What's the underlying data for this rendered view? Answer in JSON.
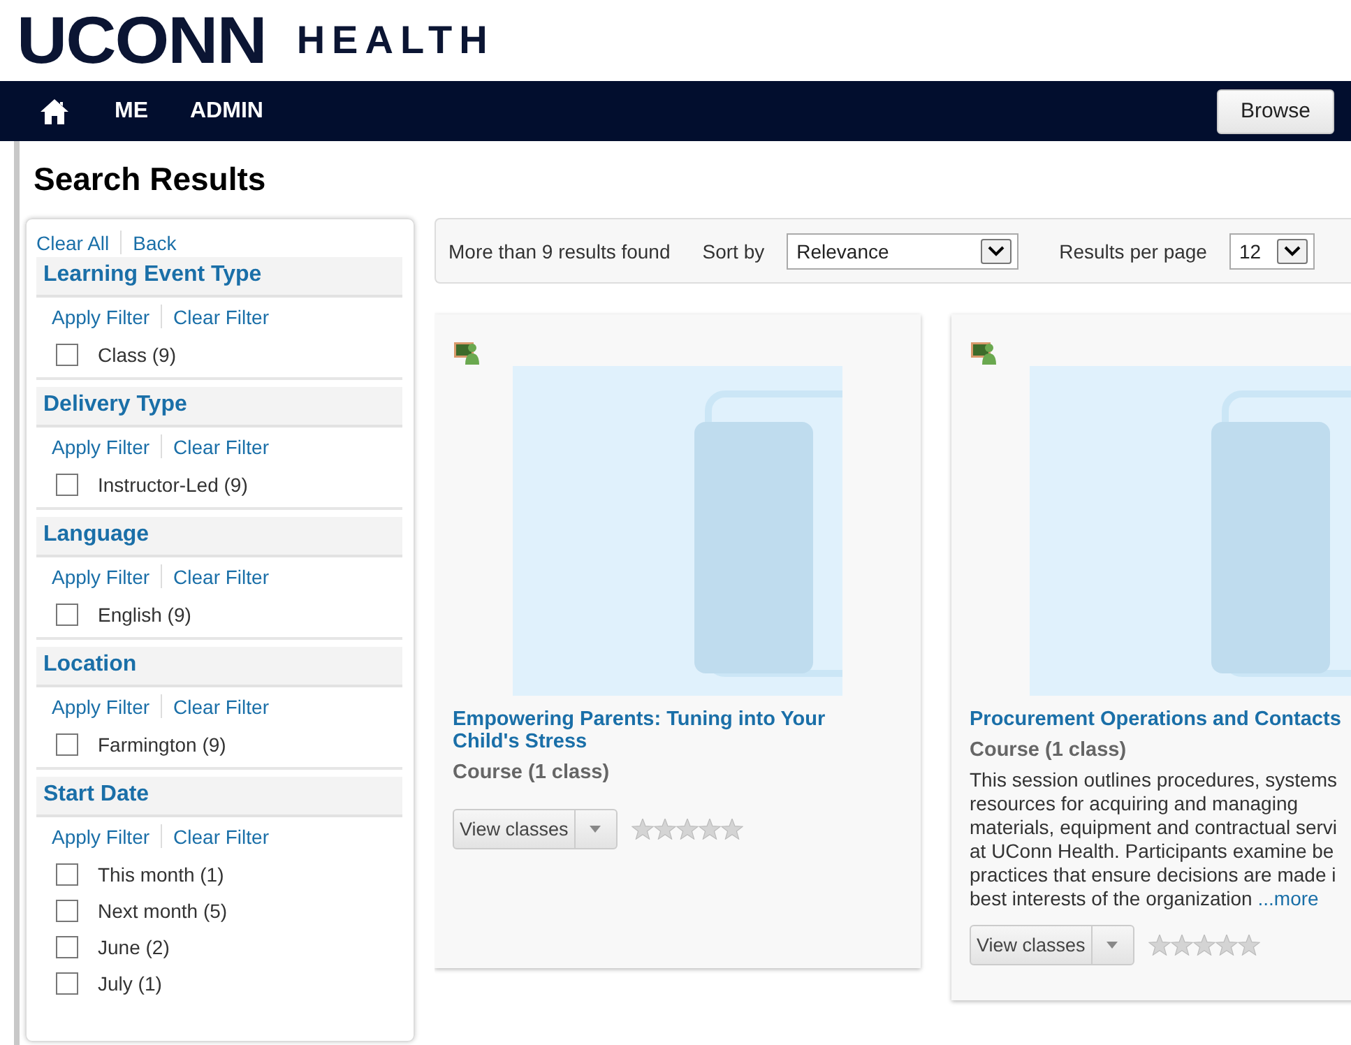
{
  "header": {
    "logo_main": "UCONN",
    "logo_sub": "HEALTH"
  },
  "nav": {
    "items": [
      {
        "kind": "home"
      },
      {
        "kind": "text",
        "label": "ME"
      },
      {
        "kind": "text",
        "label": "ADMIN"
      }
    ],
    "browse_button": "Browse"
  },
  "page_title": "Search Results",
  "filters": {
    "clear_all": "Clear All",
    "back": "Back",
    "groups": [
      {
        "title": "Learning Event Type",
        "apply": "Apply Filter",
        "clear": "Clear Filter",
        "options": [
          {
            "label": "Class (9)",
            "checked": false
          }
        ]
      },
      {
        "title": "Delivery Type",
        "apply": "Apply Filter",
        "clear": "Clear Filter",
        "options": [
          {
            "label": "Instructor-Led (9)",
            "checked": false
          }
        ]
      },
      {
        "title": "Language",
        "apply": "Apply Filter",
        "clear": "Clear Filter",
        "options": [
          {
            "label": "English (9)",
            "checked": false
          }
        ]
      },
      {
        "title": "Location",
        "apply": "Apply Filter",
        "clear": "Clear Filter",
        "options": [
          {
            "label": "Farmington (9)",
            "checked": false
          }
        ]
      },
      {
        "title": "Start Date",
        "apply": "Apply Filter",
        "clear": "Clear Filter",
        "options": [
          {
            "label": "This month (1)",
            "checked": false
          },
          {
            "label": "Next month (5)",
            "checked": false
          },
          {
            "label": "June (2)",
            "checked": false
          },
          {
            "label": "July (1)",
            "checked": false
          }
        ]
      }
    ]
  },
  "results_bar": {
    "count": "More than 9 results found",
    "sort_label": "Sort by",
    "sort_value": "Relevance",
    "per_page_label": "Results per page",
    "per_page_value": "12"
  },
  "cards": [
    {
      "title": "Empowering Parents: Tuning into Your Child's Stress",
      "type": "Course (1 class)",
      "button": "View classes",
      "stars": 0
    },
    {
      "title": "Procurement Operations and Contacts",
      "type": "Course (1 class)",
      "description_lines": [
        "This session outlines procedures, systems",
        "resources for acquiring and managing",
        "materials, equipment and contractual servi",
        "at UConn Health.  Participants examine be",
        "practices that ensure decisions are made i",
        "best interests of the organization "
      ],
      "more": "...more",
      "button": "View classes",
      "stars": 0
    }
  ]
}
